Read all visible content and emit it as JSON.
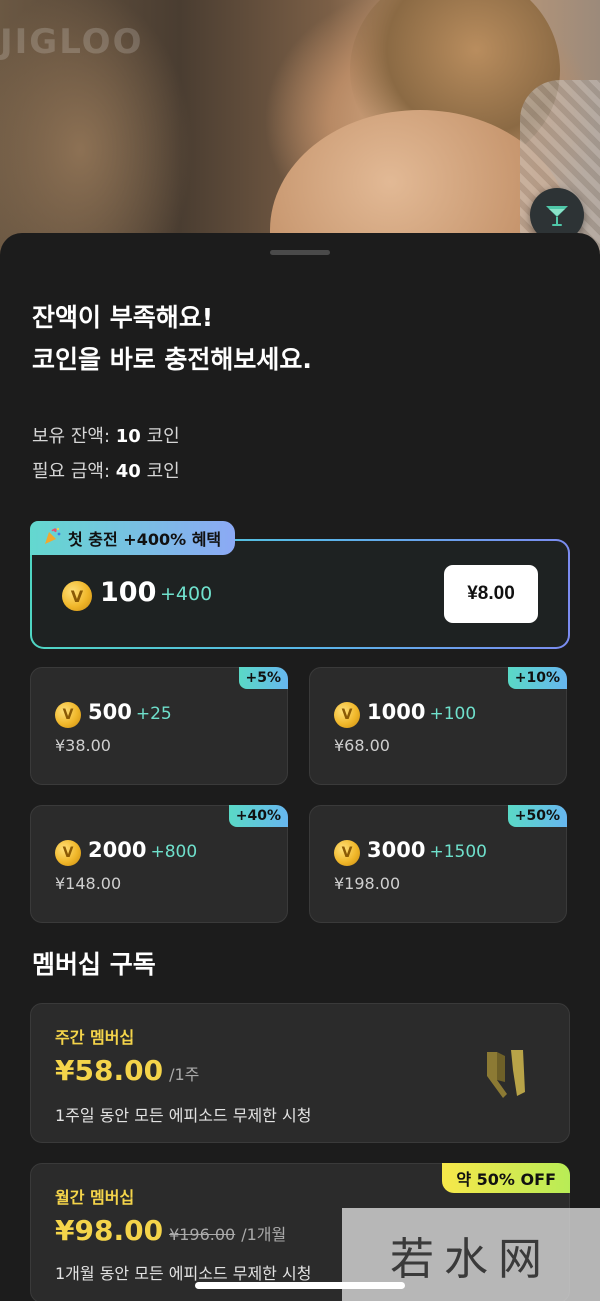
{
  "backdrop": {
    "brand": "JIGLOO"
  },
  "sheet": {
    "headline_line1": "잔액이 부족해요!",
    "headline_line2": "코인을 바로 충전해보세요.",
    "balance": {
      "label": "보유 잔액:",
      "value": "10",
      "unit": "코인"
    },
    "required": {
      "label": "필요 금액:",
      "value": "40",
      "unit": "코인"
    }
  },
  "featured": {
    "tag": "첫 충전 +400% 혜택",
    "tag_icon": "party-popper-icon",
    "amount": "100",
    "bonus": "+400",
    "price": "¥8.00"
  },
  "packages": [
    {
      "badge": "+5%",
      "amount": "500",
      "bonus": "+25",
      "price": "¥38.00"
    },
    {
      "badge": "+10%",
      "amount": "1000",
      "bonus": "+100",
      "price": "¥68.00"
    },
    {
      "badge": "+40%",
      "amount": "2000",
      "bonus": "+800",
      "price": "¥148.00"
    },
    {
      "badge": "+50%",
      "amount": "3000",
      "bonus": "+1500",
      "price": "¥198.00"
    }
  ],
  "membership": {
    "title": "멤버십 구독",
    "weekly": {
      "name": "주간 멤버십",
      "price": "¥58.00",
      "unit": "/1주",
      "desc": "1주일 동안 모든 에피소드 무제한 시청"
    },
    "monthly": {
      "name": "월간 멤버십",
      "price": "¥98.00",
      "old_price": "¥196.00",
      "unit": "/1개월",
      "desc": "1개월 동안 모든 에피소드 무제한 시청",
      "badge": "약 50% OFF"
    }
  },
  "watermark": "若水网",
  "colors": {
    "accent_yellow": "#f4d44a",
    "bonus_teal": "#6fe0cc",
    "sheet_bg": "#1c1c1c"
  }
}
